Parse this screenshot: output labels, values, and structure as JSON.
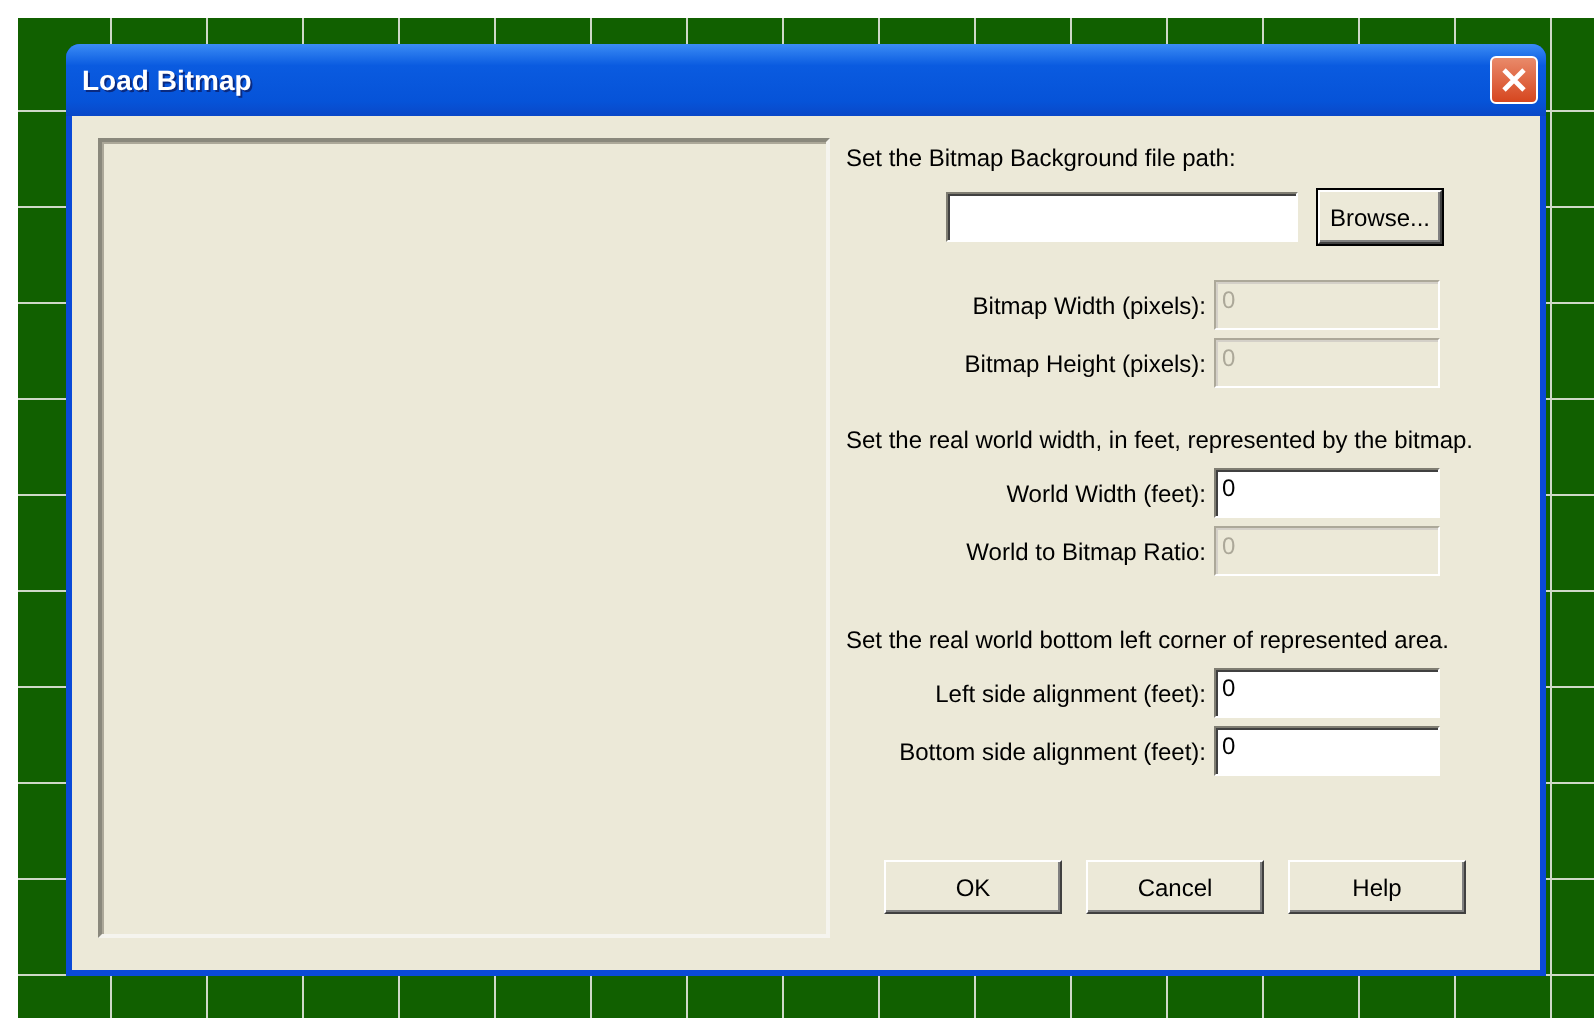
{
  "window": {
    "title": "Load Bitmap"
  },
  "file": {
    "prompt": "Set the Bitmap Background file path:",
    "browse_button": "Browse..."
  },
  "dimension_fields": [
    {
      "label": "Bitmap Width (pixels):",
      "value": "0",
      "disabled": true
    },
    {
      "label": "Bitmap Height (pixels):",
      "value": "0",
      "disabled": true
    }
  ],
  "world_prompt": "Set the real world width, in feet, represented by the bitmap.",
  "world_fields": [
    {
      "label": "World Width (feet):",
      "value": "0",
      "disabled": false
    },
    {
      "label": "World to Bitmap Ratio:",
      "value": "0",
      "disabled": true
    }
  ],
  "corner_prompt": "Set the real world bottom left corner of represented area.",
  "corner_fields": [
    {
      "label": "Left side alignment (feet):",
      "value": "0",
      "disabled": false
    },
    {
      "label": "Bottom side alignment (feet):",
      "value": "0",
      "disabled": false
    }
  ],
  "buttons": [
    "OK",
    "Cancel",
    "Help"
  ]
}
